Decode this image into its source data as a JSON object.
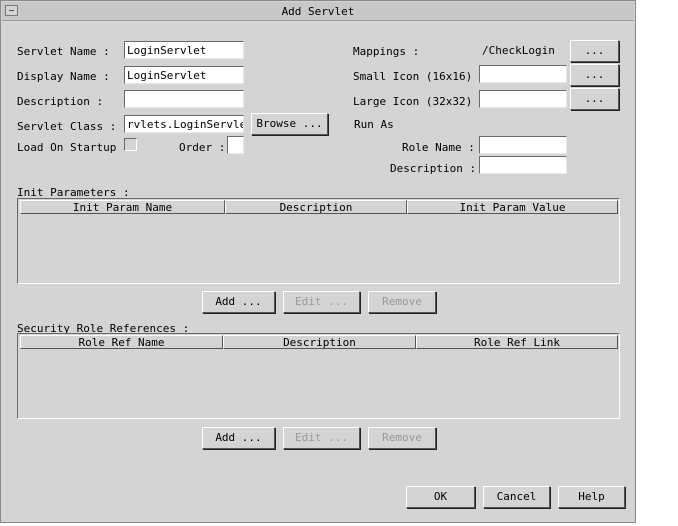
{
  "window": {
    "title": "Add Servlet"
  },
  "form": {
    "servlet_name_label": "Servlet Name :",
    "servlet_name_value": "LoginServlet",
    "display_name_label": "Display Name :",
    "display_name_value": "LoginServlet",
    "description_label": "Description :",
    "description_value": "",
    "servlet_class_label": "Servlet Class :",
    "servlet_class_value": "rvlets.LoginServlet",
    "browse_label": "Browse ...",
    "load_on_startup_label": "Load On Startup :",
    "order_label": "Order :",
    "order_value": ""
  },
  "right": {
    "mappings_label": "Mappings :",
    "mappings_value": "/CheckLogin",
    "small_icon_label": "Small Icon (16x16) :",
    "small_icon_value": "",
    "large_icon_label": "Large Icon (32x32) :",
    "large_icon_value": "",
    "ellipsis": "...",
    "run_as_label": "Run As",
    "role_name_label": "Role Name :",
    "role_name_value": "",
    "run_as_description_label": "Description :",
    "run_as_description_value": ""
  },
  "init_params": {
    "section_label": "Init Parameters :",
    "columns": [
      "Init Param Name",
      "Description",
      "Init Param Value"
    ],
    "rows": [],
    "add_label": "Add ...",
    "edit_label": "Edit ...",
    "remove_label": "Remove"
  },
  "security_roles": {
    "section_label": "Security Role References :",
    "columns": [
      "Role Ref Name",
      "Description",
      "Role Ref Link"
    ],
    "rows": [],
    "add_label": "Add ...",
    "edit_label": "Edit ...",
    "remove_label": "Remove"
  },
  "footer": {
    "ok_label": "OK",
    "cancel_label": "Cancel",
    "help_label": "Help"
  }
}
